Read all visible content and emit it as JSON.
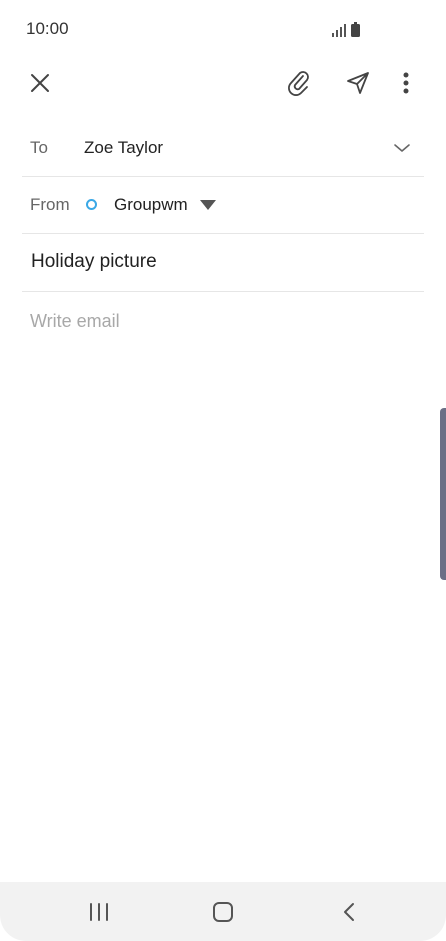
{
  "status_bar": {
    "time": "10:00",
    "icons": [
      "signal-icon",
      "battery-icon"
    ]
  },
  "toolbar": {
    "icons": [
      "close-icon",
      "paperclip-icon",
      "send-icon",
      "more-vertical-icon"
    ]
  },
  "compose": {
    "to_label": "To",
    "to_value": "Zoe Taylor",
    "from_label": "From",
    "from_value": "Groupwm",
    "subject": "Holiday picture",
    "body_placeholder": "Write email"
  },
  "colors": {
    "account_dot": "#3aa8e6",
    "edge_handle": "#6b6f86",
    "placeholder": "#a8a8a8"
  },
  "navbar": {
    "icons": [
      "recents-icon",
      "home-icon",
      "back-icon"
    ]
  }
}
